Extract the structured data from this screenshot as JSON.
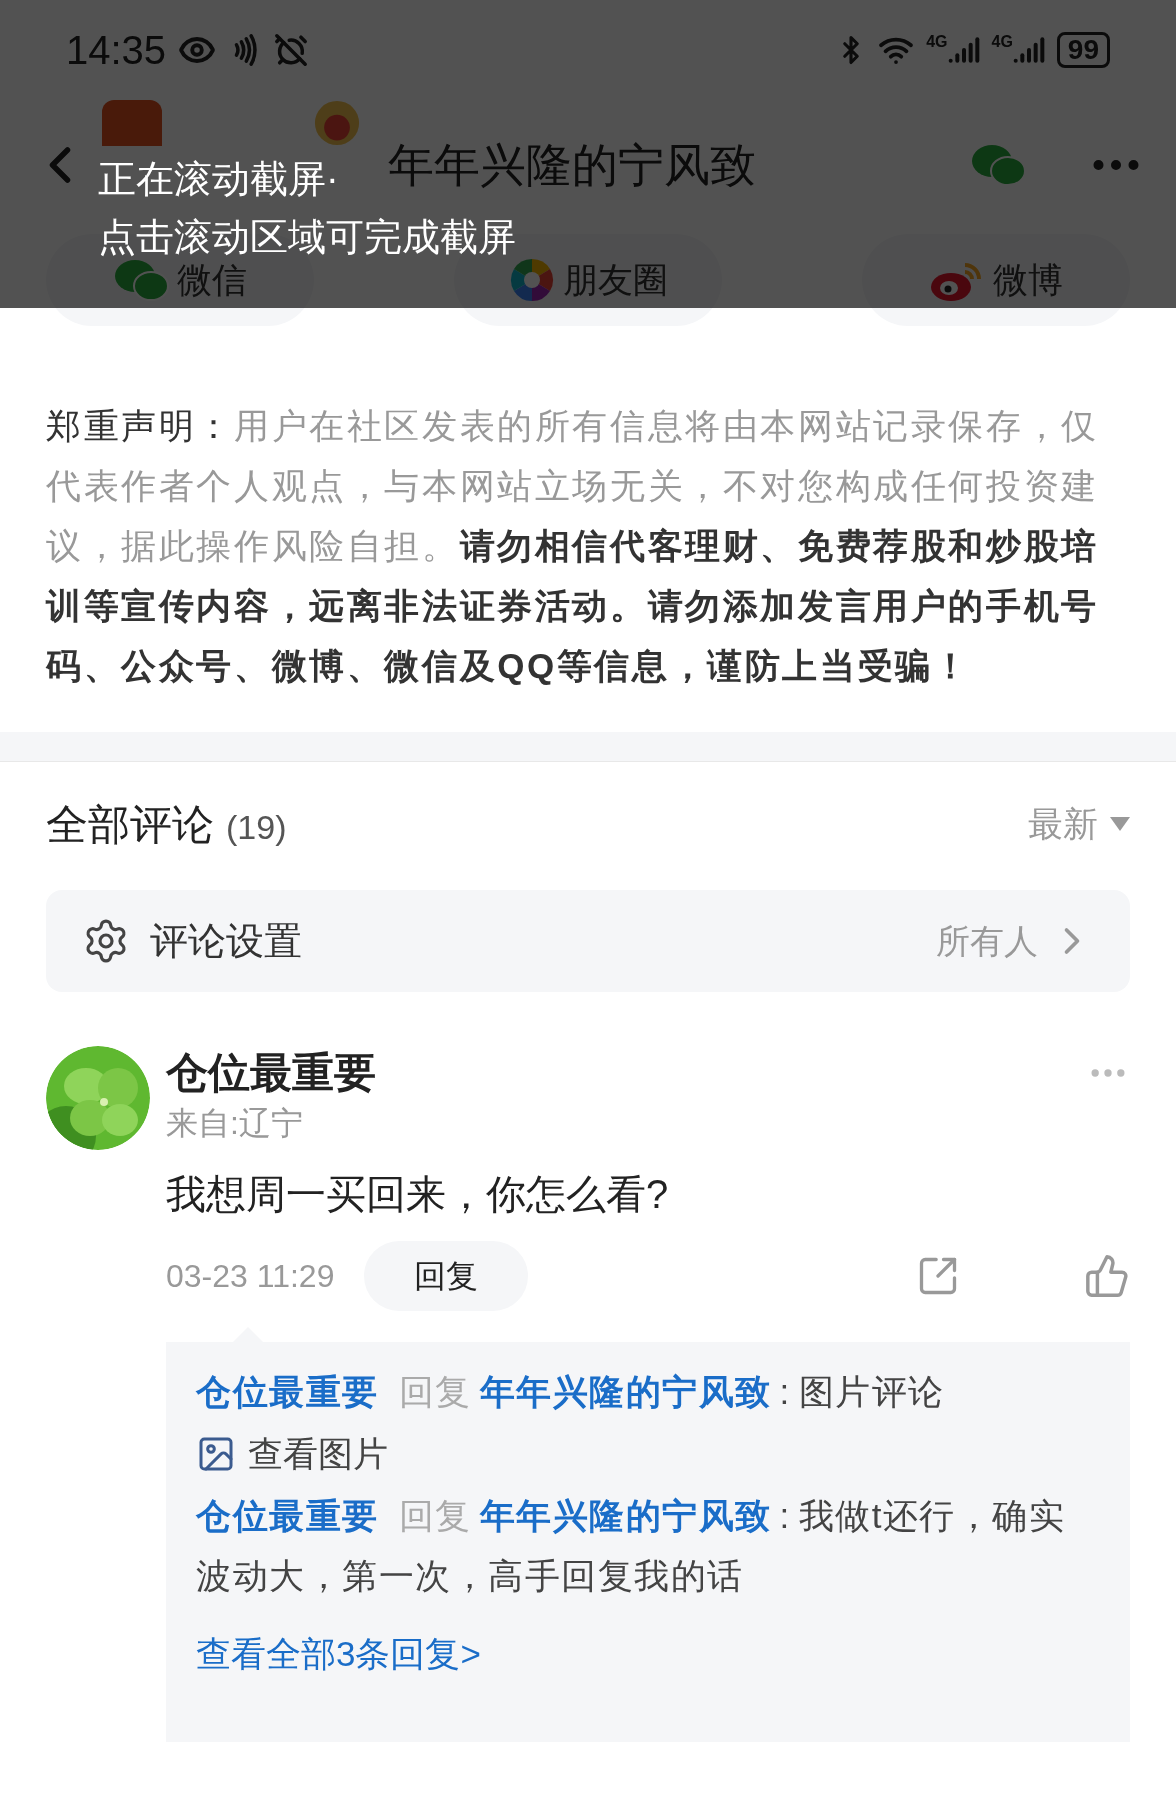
{
  "status_bar": {
    "time": "14:35",
    "network_labels": [
      "4G",
      "4G"
    ],
    "battery": "99"
  },
  "header": {
    "title": "年年兴隆的宁风致"
  },
  "toast": {
    "lines": [
      "正在滚动截屏·",
      "点击滚动区域可完成截屏"
    ]
  },
  "share_options": [
    {
      "label": "微信",
      "kind": "wechat"
    },
    {
      "label": "朋友圈",
      "kind": "moments"
    },
    {
      "label": "微博",
      "kind": "weibo"
    }
  ],
  "disclaimer": [
    {
      "kind": "label",
      "text": "郑重声明："
    },
    {
      "kind": "normal",
      "text": "用户在社区发表的所有信息将由本网站记录保存，仅代表作者个人观点，与本网站立场无关，不对您构成任何投资建议，据此操作风险自担。"
    },
    {
      "kind": "emphasis",
      "text": "请勿相信代客理财、免费荐股和炒股培训等宣传内容，远离非法证券活动。请勿添加发言用户的手机号码、公众号、微博、微信及QQ等信息，谨防上当受骗！"
    }
  ],
  "comments_header": {
    "title": "全部评论",
    "count": "(19)",
    "sort": "最新"
  },
  "comment_settings": {
    "label": "评论设置",
    "value": "所有人"
  },
  "comments": [
    {
      "author": "仓位最重要",
      "location": "来自:辽宁",
      "text": "我想周一买回来，你怎么看?",
      "time": "03-23 11:29",
      "reply_button": "回复",
      "replies": [
        {
          "author": "仓位最重要",
          "action": "回复",
          "target": "年年兴隆的宁风致",
          "separator": ":",
          "text": "图片评论",
          "attachment": "查看图片"
        },
        {
          "author": "仓位最重要",
          "action": "回复",
          "target": "年年兴隆的宁风致",
          "separator": ":",
          "text": "我做t还行，确实波动大，第一次，高手回复我的话"
        }
      ],
      "more_replies": "查看全部3条回复>"
    }
  ]
}
